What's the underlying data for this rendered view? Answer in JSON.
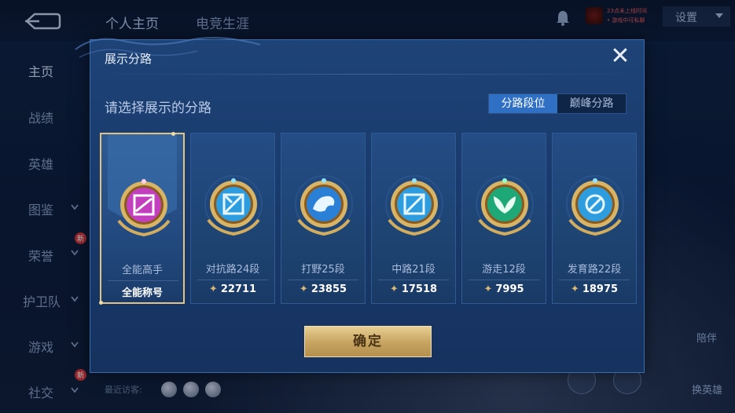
{
  "app": {
    "top_tabs": [
      "个人主页",
      "电竞生涯"
    ],
    "settings_label": "设置",
    "sidebar": [
      {
        "label": "主页",
        "chevron": false,
        "new": false
      },
      {
        "label": "战绩",
        "chevron": false,
        "new": false
      },
      {
        "label": "英雄",
        "chevron": false,
        "new": false
      },
      {
        "label": "图鉴",
        "chevron": true,
        "new": false
      },
      {
        "label": "荣誉",
        "chevron": true,
        "new": true
      },
      {
        "label": "护卫队",
        "chevron": true,
        "new": false
      },
      {
        "label": "游戏",
        "chevron": true,
        "new": false
      },
      {
        "label": "社交",
        "chevron": true,
        "new": true
      }
    ],
    "new_tag": "新",
    "recent_visitors_label": "最近访客:",
    "right_labels": [
      "陪伴",
      "换英雄"
    ],
    "mini_text_1": "23点未上线时间",
    "mini_text_2": "• 游戏中可私聊"
  },
  "modal": {
    "title": "展示分路",
    "close_icon": "close-icon",
    "subtitle": "请选择展示的分路",
    "segments": [
      "分路段位",
      "巅峰分路"
    ],
    "active_segment": 0,
    "cards": [
      {
        "label": "全能高手",
        "bottom": "全能称号",
        "selected": true,
        "badge_color": "#c43fc0",
        "icon": "all-round-icon"
      },
      {
        "label": "对抗路24段",
        "score": "22711",
        "selected": false,
        "badge_color": "#2e9de0",
        "icon": "clash-lane-icon"
      },
      {
        "label": "打野25段",
        "score": "23855",
        "selected": false,
        "badge_color": "#2a7fd6",
        "icon": "jungle-icon"
      },
      {
        "label": "中路21段",
        "score": "17518",
        "selected": false,
        "badge_color": "#2e9de0",
        "icon": "mid-lane-icon"
      },
      {
        "label": "游走12段",
        "score": "7995",
        "selected": false,
        "badge_color": "#1fa877",
        "icon": "roam-icon"
      },
      {
        "label": "发育路22段",
        "score": "18975",
        "selected": false,
        "badge_color": "#2e9de0",
        "icon": "farm-lane-icon"
      }
    ],
    "confirm_label": "确定"
  }
}
